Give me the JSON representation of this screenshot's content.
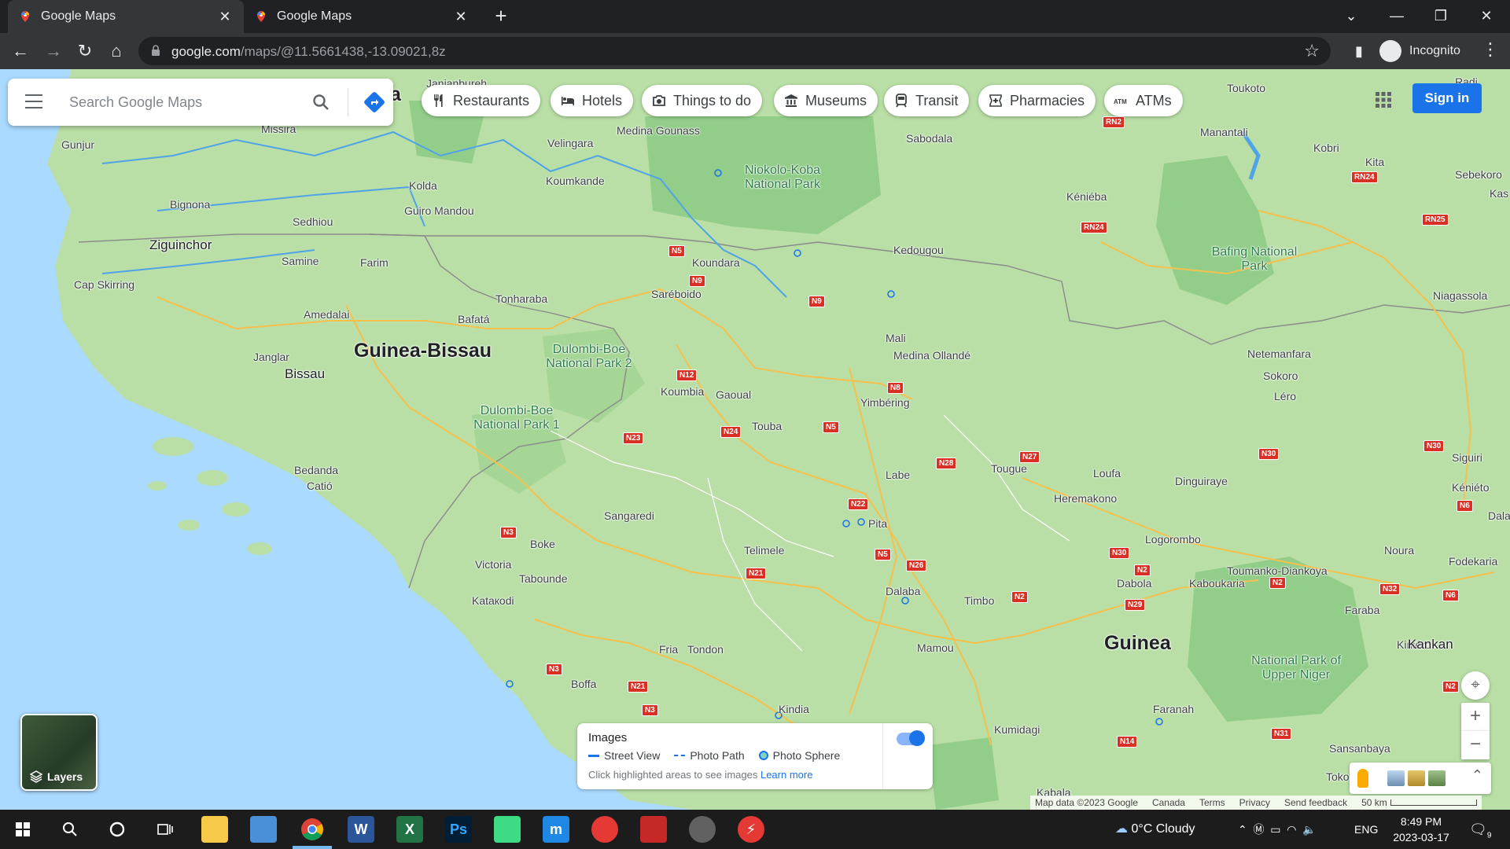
{
  "browser": {
    "tabs": [
      {
        "title": "Google Maps",
        "active": true
      },
      {
        "title": "Google Maps",
        "active": false
      }
    ],
    "url_host": "google.com",
    "url_path": "/maps/@11.5661438,-13.09021,8z",
    "profile_label": "Incognito"
  },
  "search": {
    "placeholder": "Search Google Maps"
  },
  "chips": [
    {
      "label": "Restaurants",
      "icon": "fork-knife-icon"
    },
    {
      "label": "Hotels",
      "icon": "bed-icon"
    },
    {
      "label": "Things to do",
      "icon": "camera-icon"
    },
    {
      "label": "Museums",
      "icon": "museum-icon"
    },
    {
      "label": "Transit",
      "icon": "train-icon"
    },
    {
      "label": "Pharmacies",
      "icon": "pharmacy-icon"
    },
    {
      "label": "ATMs",
      "icon": "atm-icon"
    }
  ],
  "signin_label": "Sign in",
  "layers_label": "Layers",
  "images_panel": {
    "title": "Images",
    "street_view": "Street View",
    "photo_path": "Photo Path",
    "photo_sphere": "Photo Sphere",
    "hint": "Click highlighted areas to see images",
    "learn_more": "Learn more",
    "toggle_on": true
  },
  "map": {
    "countries": [
      "Guinea-Bissau",
      "Guinea"
    ],
    "partial_label": "a",
    "cities": [
      "Ziguinchor",
      "Bissau",
      "Kankan"
    ],
    "places": [
      "Janjanbureh",
      "Velingara",
      "Medina Gounass",
      "Sabodala",
      "Manantali",
      "Toukoto",
      "Kobri",
      "Kita",
      "Sebekoro",
      "Kas",
      "Radi",
      "Gunjur",
      "Missira",
      "Bignona",
      "Sedhiou",
      "Kolda",
      "Guiro Mandou",
      "Koumkande",
      "Kéniéba",
      "Samine",
      "Farim",
      "Koundara",
      "Kedougou",
      "Cap Skirring",
      "Saréboido",
      "Tonharaba",
      "Amedalai",
      "Bafatá",
      "Niagassola",
      "Mali",
      "Medina Ollandé",
      "Netemanfara",
      "Sokoro",
      "Léro",
      "Janglar",
      "Koumbia",
      "Gaoual",
      "Yimbéring",
      "Touba",
      "Tougue",
      "Loufa",
      "Dinguiraye",
      "Heremakono",
      "Siguiri",
      "Kéniéto",
      "Bedanda",
      "Catió",
      "Labe",
      "Dala",
      "Sangaredi",
      "Pita",
      "Logorombo",
      "Boke",
      "Telimele",
      "Toumanko-Diankoya",
      "Noura",
      "Fodekaria",
      "Victoria",
      "Tabounde",
      "Dabola",
      "Kaboukaria",
      "Kataкodi",
      "Dalaba",
      "Timbo",
      "Faraba",
      "Kiniéro",
      "Fria",
      "Tondon",
      "Mamou",
      "Boffa",
      "Kindia",
      "Faranah",
      "Kumidagi",
      "Sansanbaya",
      "Kabala",
      "Toko"
    ],
    "parks": [
      "Niokolo-Koba National Park",
      "Bafing National Park",
      "Dulombi-Boe National Park 2",
      "Dulombi-Boe National Park 1",
      "National Park of Upper Niger"
    ],
    "roads": [
      "RN2",
      "RN24",
      "RN24",
      "RN25",
      "N5",
      "N9",
      "N9",
      "N12",
      "N8",
      "N24",
      "N5",
      "N23",
      "N28",
      "N27",
      "N30",
      "N30",
      "N6",
      "N22",
      "N3",
      "N5",
      "N26",
      "N21",
      "N30",
      "N2",
      "N2",
      "N32",
      "N6",
      "N2",
      "N29",
      "N3",
      "N21",
      "N3",
      "N2",
      "N14",
      "N31"
    ]
  },
  "footer": {
    "attribution": "Map data ©2023 Google",
    "region": "Canada",
    "terms": "Terms",
    "privacy": "Privacy",
    "feedback": "Send feedback",
    "scale": "50 km"
  },
  "taskbar": {
    "weather": "0°C  Cloudy",
    "lang": "ENG",
    "time": "8:49 PM",
    "date": "2023-03-17",
    "notifications": "9"
  },
  "colors": {
    "land": "#b9dfa6",
    "water": "#aadaff",
    "forest": "#93cd8a",
    "accent": "#1a73e8"
  }
}
